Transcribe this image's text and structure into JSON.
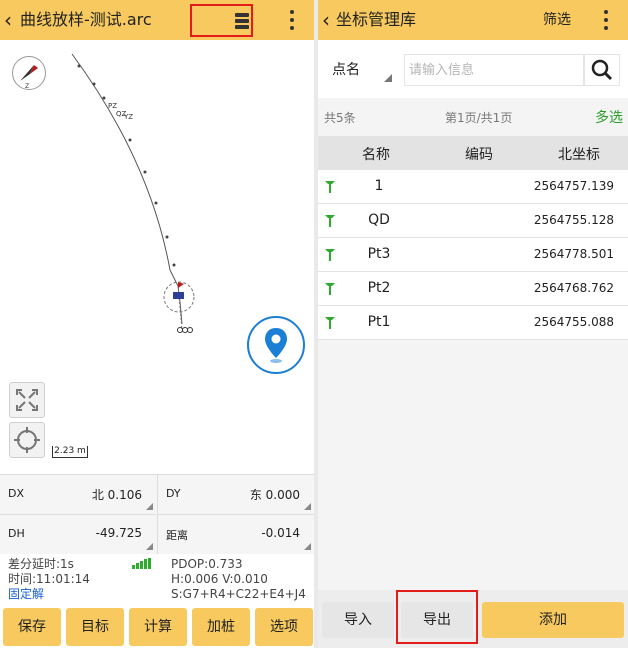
{
  "left": {
    "title": "曲线放样-测试.arc",
    "map": {
      "scale_label": "2.23 m",
      "point_labels": [
        "PZ",
        "QZ",
        "YZ"
      ]
    },
    "readout": [
      {
        "label": "DX",
        "value": "北 0.106"
      },
      {
        "label": "DY",
        "value": "东 0.000"
      },
      {
        "label": "DH",
        "value": "-49.725"
      },
      {
        "label": "距离",
        "value": "-0.014"
      }
    ],
    "status": {
      "delay": "差分延时:1s",
      "time": "时间:11:01:14",
      "fix": "固定解",
      "pdop": "PDOP:0.733",
      "hv": "H:0.006  V:0.010",
      "sats": "S:G7+R4+C22+E4+J4"
    },
    "buttons": [
      "保存",
      "目标",
      "计算",
      "加桩",
      "选项"
    ]
  },
  "right": {
    "title": "坐标管理库",
    "filter_label": "筛选",
    "search_field": "点名",
    "search_placeholder": "请输入信息",
    "count_text": "共5条",
    "page_text": "第1页/共1页",
    "multi_label": "多选",
    "columns": [
      "名称",
      "编码",
      "北坐标"
    ],
    "rows": [
      {
        "name": "1",
        "code": "",
        "north": "2564757.139"
      },
      {
        "name": "QD",
        "code": "",
        "north": "2564755.128"
      },
      {
        "name": "Pt3",
        "code": "",
        "north": "2564778.501"
      },
      {
        "name": "Pt2",
        "code": "",
        "north": "2564768.762"
      },
      {
        "name": "Pt1",
        "code": "",
        "north": "2564755.088"
      }
    ],
    "footer": {
      "import_label": "导入",
      "export_label": "导出",
      "add_label": "添加"
    }
  },
  "colors": {
    "header": "#f7c95f",
    "accent_green": "#2a9c2a",
    "highlight_red": "#e21b1b",
    "locate_blue": "#1c7fd6",
    "fix_blue": "#1a5fd1"
  },
  "icons": [
    "back-chevron-icon",
    "kebab-menu-icon",
    "layers-icon",
    "compass-icon",
    "fullscreen-icon",
    "crosshair-icon",
    "location-pin-icon",
    "search-icon",
    "point-pin-icon",
    "signal-bars-icon"
  ]
}
